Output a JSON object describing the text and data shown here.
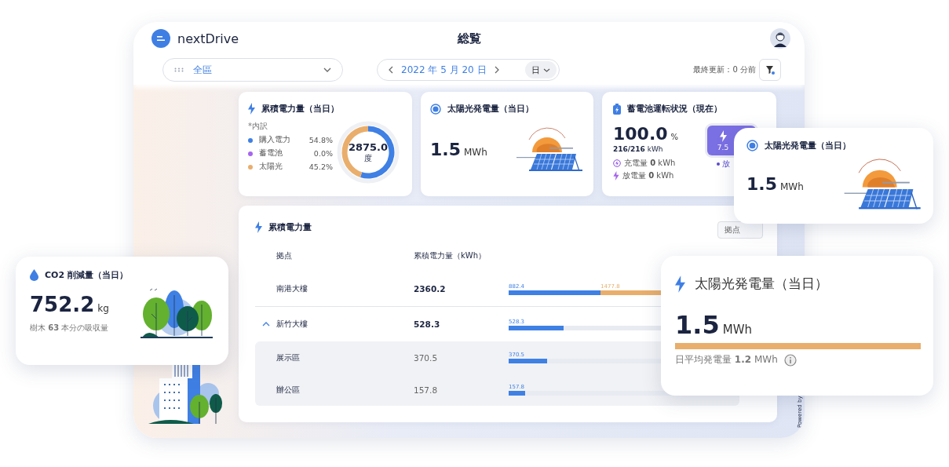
{
  "header": {
    "logo": "nextDrive",
    "title": "総覧"
  },
  "toolbar": {
    "area": "全區",
    "year": "2022",
    "year_unit": "年",
    "month": "5",
    "month_unit": "月",
    "day": "20",
    "day_unit": "日",
    "period": "日",
    "last_updated": "最終更新：0 分前"
  },
  "consumption_card": {
    "title": "累積電力量（当日）",
    "breakdown_label": "*内訳",
    "total": "2875.0",
    "total_unit": "度",
    "items": [
      {
        "name": "購入電力",
        "percent": "54.8%",
        "color": "#3f80e4"
      },
      {
        "name": "蓄電池",
        "percent": "0.0%",
        "color": "#a666ec"
      },
      {
        "name": "太陽光",
        "percent": "45.2%",
        "color": "#e9ae6c"
      }
    ],
    "chart_data": {
      "type": "donut",
      "values": [
        54.8,
        0.0,
        45.2
      ]
    }
  },
  "solar_card": {
    "title": "太陽光発電量（当日）",
    "value": "1.5",
    "unit": "MWh"
  },
  "battery_card": {
    "title": "蓄電池運転状況（現在）",
    "charge": "100.0",
    "charge_unit": "%",
    "capacity": "**216/216** kWh",
    "badge_value": "7.5",
    "status": "放",
    "rows": [
      {
        "kind": "charge",
        "text": "充電量 **0** kWh"
      },
      {
        "kind": "discharge",
        "text": "放電量 **0** kWh"
      }
    ]
  },
  "totals_card": {
    "title": "累積電力量",
    "filter_button": "拠点",
    "columns": [
      "拠点",
      "累積電力量（kWh）"
    ],
    "rows": [
      {
        "name": "南港大樓",
        "value": "2360.2",
        "segments": [
          {
            "label": "882.4",
            "level": 0.366,
            "color": "#3f80e4"
          },
          {
            "label": "1477.8",
            "color": "#e9ae6c"
          }
        ]
      },
      {
        "name": "新竹大樓",
        "value": "528.3",
        "expanded": true,
        "segments": [
          {
            "label": "528.3",
            "level": 0.219,
            "color": "#3f80e4"
          }
        ],
        "children": [
          {
            "name": "展示區",
            "value": "370.5",
            "segments": [
              {
                "label": "370.5",
                "level": 0.153,
                "color": "#3f80e4"
              }
            ]
          },
          {
            "name": "辦公區",
            "value": "157.8",
            "segments": [
              {
                "label": "157.8",
                "level": 0.065,
                "color": "#3f80e4"
              }
            ]
          }
        ]
      }
    ]
  },
  "footer": "Powered by",
  "co2_card": {
    "title": "CO2 削減量（当日）",
    "value": "752.2",
    "unit": "kg",
    "note": "樹木 **63** 本分の吸収量"
  },
  "solar_popup": {
    "title": "太陽光発電量（当日）",
    "value": "1.5",
    "unit": "MWh"
  },
  "solar_detail": {
    "title": "太陽光発電量（当日）",
    "value": "1.5",
    "unit": "MWh",
    "level": 1,
    "average": "日平均発電量 **1.2** MWh"
  }
}
